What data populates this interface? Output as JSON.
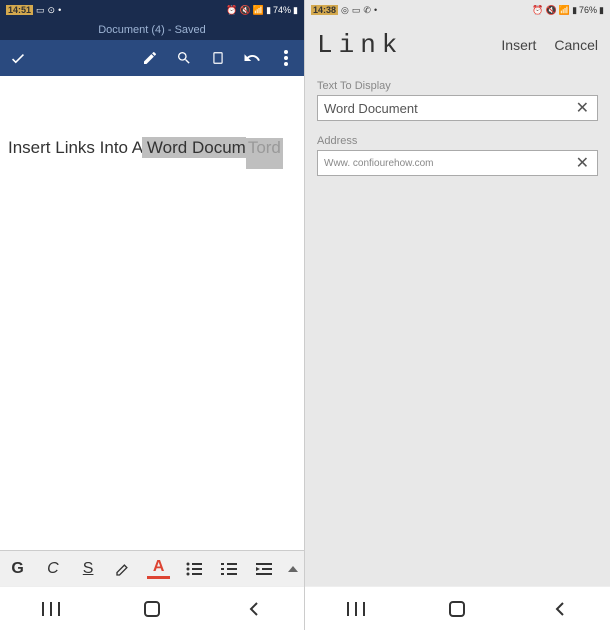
{
  "left": {
    "status": {
      "time": "14:51",
      "battery": "74%"
    },
    "docTitle": "Document (4) - Saved",
    "docText": {
      "prefix": "Insert Links Into A",
      "selected": " Word Docum",
      "suffix": "Tord"
    },
    "fmt": {
      "bold": "G",
      "italic": "C",
      "underline": "S",
      "color": "A"
    }
  },
  "right": {
    "status": {
      "time": "14:38",
      "battery": "76%"
    },
    "header": {
      "title": "Link",
      "insert": "Insert",
      "cancel": "Cancel"
    },
    "displayLabel": "Text To Display",
    "displayValue": "Word Document",
    "addressLabel": "Address",
    "addressValue": "Www. confiourehow.com"
  }
}
